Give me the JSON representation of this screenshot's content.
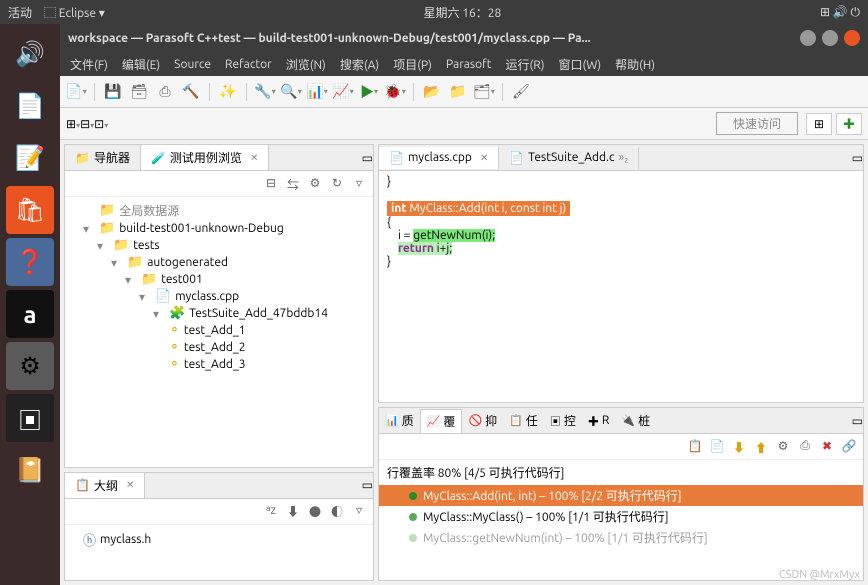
{
  "topbar": {
    "activities": "活动",
    "app": "Eclipse",
    "clock": "星期六 16：28"
  },
  "launcher_icons": [
    "🔊",
    "📄",
    "📝",
    "🛍",
    "❓",
    "a",
    "⚙",
    "▣",
    "📔"
  ],
  "window": {
    "title": "workspace — Parasoft C++test — build-test001-unknown-Debug/test001/myclass.cpp — Pa..."
  },
  "menu": [
    "文件(F)",
    "编辑(E)",
    "Source",
    "Refactor",
    "浏览(N)",
    "搜索(A)",
    "项目(P)",
    "Parasoft",
    "运行(R)",
    "窗口(W)",
    "帮助(H)"
  ],
  "quick_access": "快速访问",
  "nav": {
    "tab1": "导航器",
    "tab2": "测试用例浏览",
    "rows": [
      {
        "ind": 1,
        "tw": "",
        "icon": "📁",
        "label": "全局数据源",
        "color": "#888"
      },
      {
        "ind": 1,
        "tw": "▾",
        "icon": "📁",
        "label": "build-test001-unknown-Debug"
      },
      {
        "ind": 2,
        "tw": "▾",
        "icon": "📁",
        "label": "tests"
      },
      {
        "ind": 3,
        "tw": "▾",
        "icon": "📁",
        "label": "autogenerated"
      },
      {
        "ind": 4,
        "tw": "▾",
        "icon": "📁",
        "label": "test001"
      },
      {
        "ind": 5,
        "tw": "▾",
        "icon": "📄",
        "label": "myclass.cpp"
      },
      {
        "ind": 6,
        "tw": "▾",
        "icon": "🧩",
        "label": "TestSuite_Add_47bddb14"
      },
      {
        "ind": 6,
        "tw": "",
        "icon": "⚬",
        "label": "test_Add_1"
      },
      {
        "ind": 6,
        "tw": "",
        "icon": "⚬",
        "label": "test_Add_2"
      },
      {
        "ind": 6,
        "tw": "",
        "icon": "⚬",
        "label": "test_Add_3"
      }
    ]
  },
  "outline": {
    "tab": "大纲",
    "file": "myclass.h"
  },
  "editor": {
    "tab1": "myclass.cpp",
    "tab2": "TestSuite_Add.c",
    "tab2_decor": "»₂",
    "sig_pre": "int ",
    "sig_cls": "MyClass::Add",
    "sig_args": "(int i, const int j)",
    "l_open": "{",
    "l_close": "}",
    "l1_a": "    i = ",
    "l1_b": "getNewNum(i);",
    "l2_a": "    ",
    "l2_kw": "return",
    "l2_b": " i+j;"
  },
  "bottom": {
    "tabs": [
      "质",
      "覆",
      "抑",
      "任",
      "控",
      "R",
      "桩"
    ],
    "icons": [
      "📋",
      "📄",
      "⬇",
      "⬆",
      "⚙",
      "⎙",
      "✖",
      "🔗"
    ],
    "head": "行覆盖率 80% [4/5 可执行代码行]",
    "r1": "MyClass::Add(int, int) – 100% [2/2 可执行代码行]",
    "r2": "MyClass::MyClass() – 100% [1/1 可执行代码行]",
    "r3": "MyClass::getNewNum(int) – 100% [1/1 可执行代码行]"
  },
  "watermark": "CSDN @MrxMyx"
}
